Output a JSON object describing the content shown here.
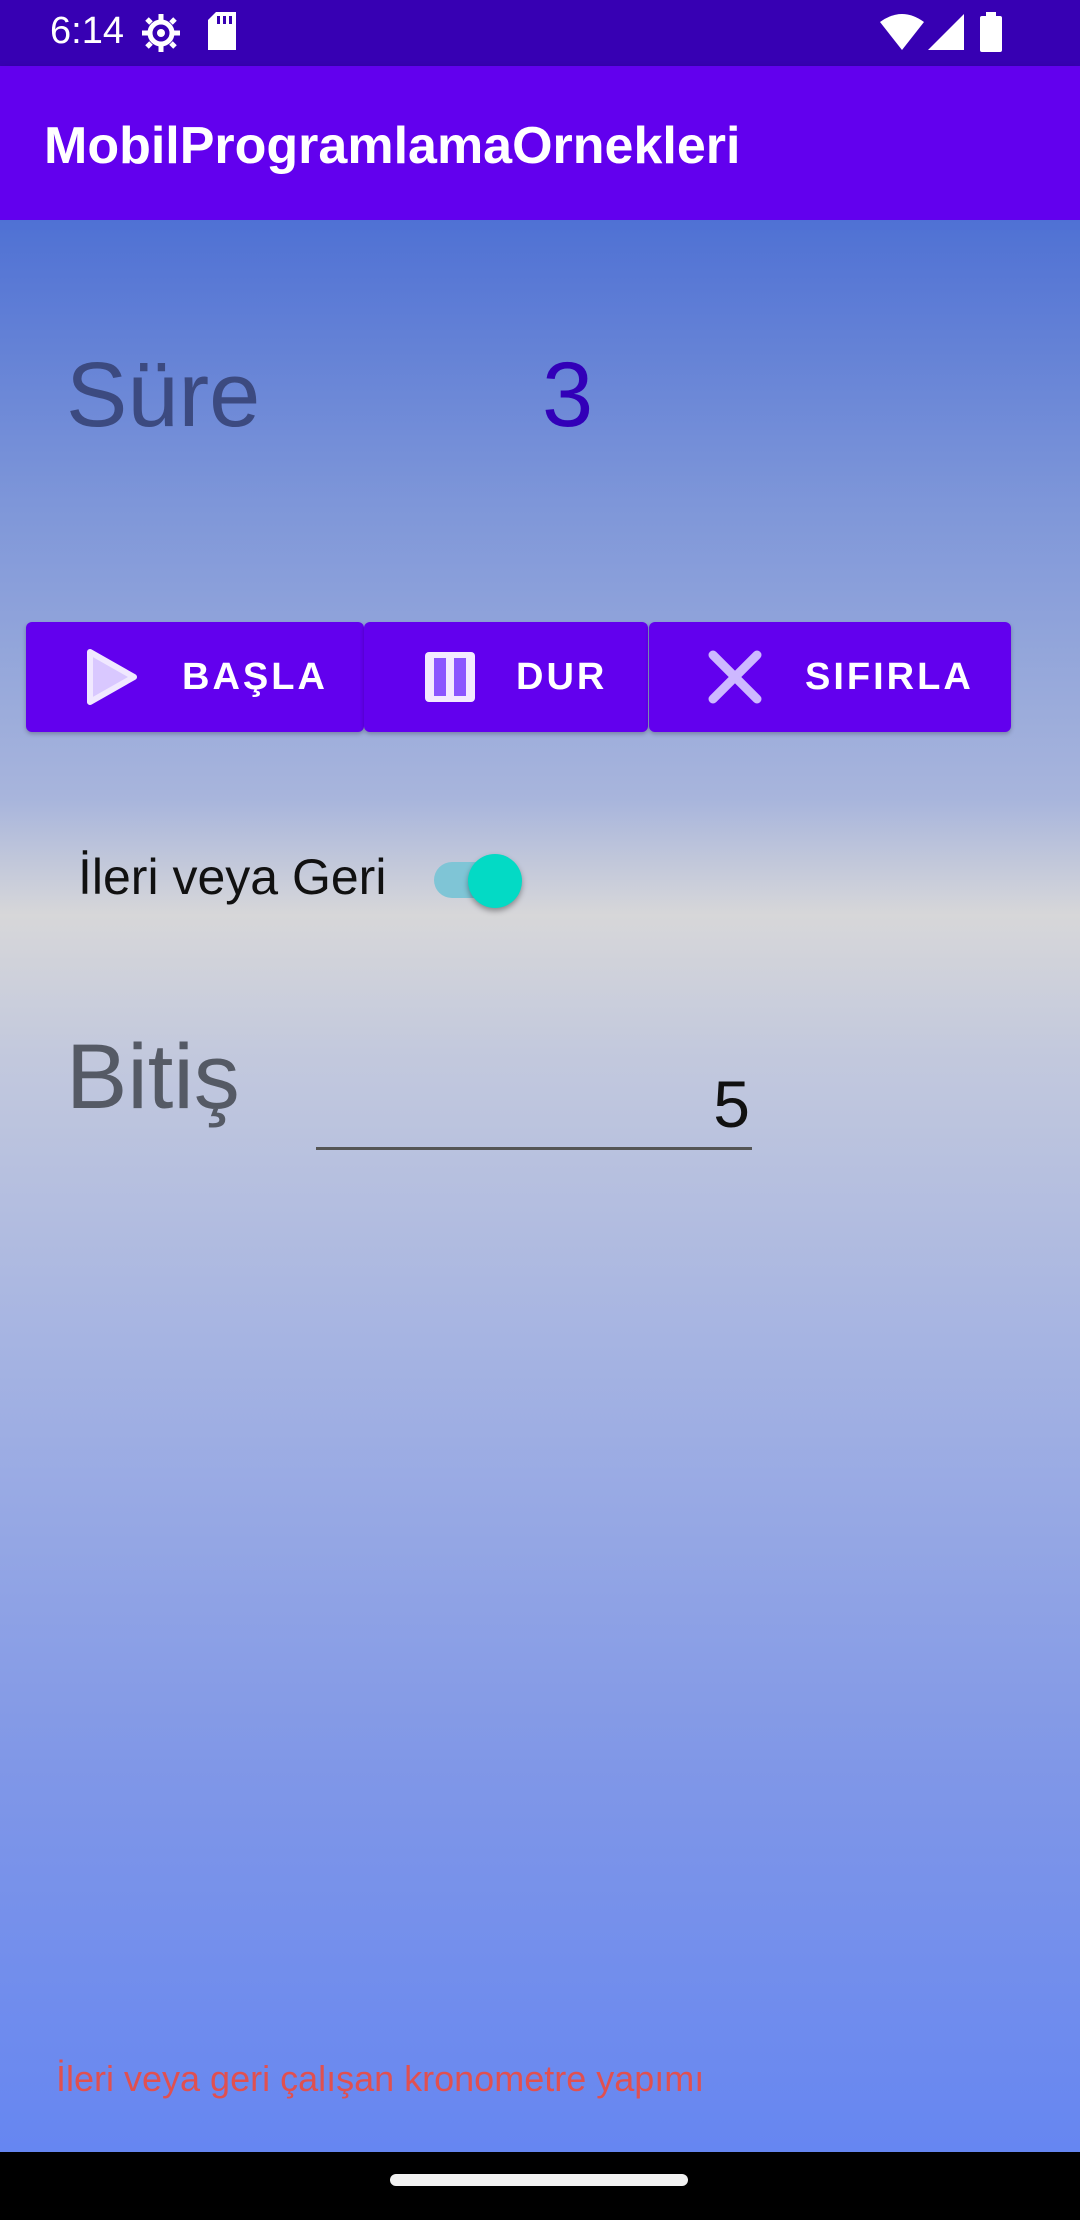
{
  "status_bar": {
    "time": "6:14",
    "icons": [
      "settings-icon",
      "sd-card-icon",
      "wifi-icon",
      "signal-icon",
      "battery-icon"
    ]
  },
  "app_bar": {
    "title": "MobilProgramlamaOrnekleri"
  },
  "timer": {
    "label": "Süre",
    "value": "3"
  },
  "buttons": {
    "start": {
      "label": "BAŞLA",
      "icon": "play-icon"
    },
    "pause": {
      "label": "DUR",
      "icon": "pause-icon"
    },
    "reset": {
      "label": "SIFIRLA",
      "icon": "close-icon"
    }
  },
  "direction_switch": {
    "label": "İleri veya Geri",
    "checked": true
  },
  "end": {
    "label": "Bitiş",
    "value": "5"
  },
  "footer": {
    "text": "İleri veya geri çalışan kronometre yapımı"
  },
  "colors": {
    "primary": "#6200EE",
    "primary_dark": "#3700B3",
    "accent": "#03DAC5",
    "footer_text": "#e05050"
  }
}
